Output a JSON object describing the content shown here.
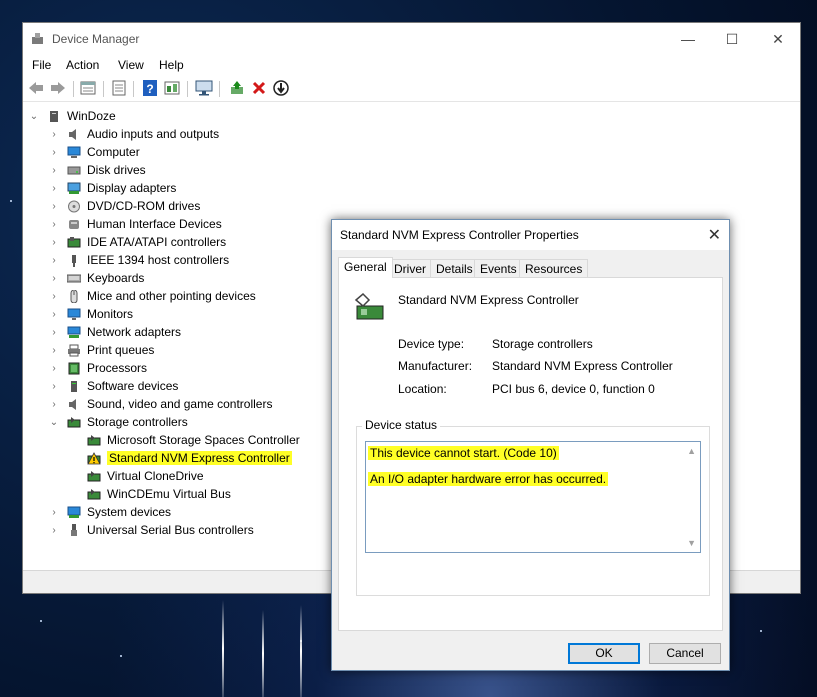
{
  "window": {
    "title": "Device Manager",
    "controls": {
      "minimize": "—",
      "maximize": "☐",
      "close": "✕"
    }
  },
  "menu": [
    "File",
    "Action",
    "View",
    "Help"
  ],
  "tree": {
    "root": "WinDoze",
    "categories": [
      {
        "label": "Audio inputs and outputs",
        "icon": "speaker-icon"
      },
      {
        "label": "Computer",
        "icon": "computer-icon"
      },
      {
        "label": "Disk drives",
        "icon": "disk-drive-icon"
      },
      {
        "label": "Display adapters",
        "icon": "display-adapter-icon"
      },
      {
        "label": "DVD/CD-ROM drives",
        "icon": "dvd-icon"
      },
      {
        "label": "Human Interface Devices",
        "icon": "hid-icon"
      },
      {
        "label": "IDE ATA/ATAPI controllers",
        "icon": "ide-controller-icon"
      },
      {
        "label": "IEEE 1394 host controllers",
        "icon": "ieee1394-icon"
      },
      {
        "label": "Keyboards",
        "icon": "keyboard-icon"
      },
      {
        "label": "Mice and other pointing devices",
        "icon": "mouse-icon"
      },
      {
        "label": "Monitors",
        "icon": "monitor-icon"
      },
      {
        "label": "Network adapters",
        "icon": "network-adapter-icon"
      },
      {
        "label": "Print queues",
        "icon": "printer-icon"
      },
      {
        "label": "Processors",
        "icon": "processor-icon"
      },
      {
        "label": "Software devices",
        "icon": "software-device-icon"
      },
      {
        "label": "Sound, video and game controllers",
        "icon": "sound-icon"
      },
      {
        "label": "Storage controllers",
        "icon": "storage-controller-icon"
      }
    ],
    "storage_children": [
      "Microsoft Storage Spaces Controller",
      "Standard NVM Express Controller",
      "Virtual CloneDrive",
      "WinCDEmu Virtual Bus"
    ],
    "after": [
      {
        "label": "System devices",
        "icon": "system-device-icon"
      },
      {
        "label": "Universal Serial Bus controllers",
        "icon": "usb-icon"
      }
    ]
  },
  "dialog": {
    "title": "Standard NVM Express Controller Properties",
    "tabs": [
      "General",
      "Driver",
      "Details",
      "Events",
      "Resources"
    ],
    "device_name": "Standard NVM Express Controller",
    "fields": {
      "device_type_label": "Device type:",
      "device_type": "Storage controllers",
      "manufacturer_label": "Manufacturer:",
      "manufacturer": "Standard NVM Express Controller",
      "location_label": "Location:",
      "location": "PCI bus 6, device 0, function 0"
    },
    "status_group": "Device status",
    "status_line1": "This device cannot start. (Code 10)",
    "status_line2": "An I/O adapter hardware error has occurred.",
    "ok": "OK",
    "cancel": "Cancel"
  },
  "colors": {
    "highlight": "#ffff26",
    "accent": "#0078d7"
  }
}
